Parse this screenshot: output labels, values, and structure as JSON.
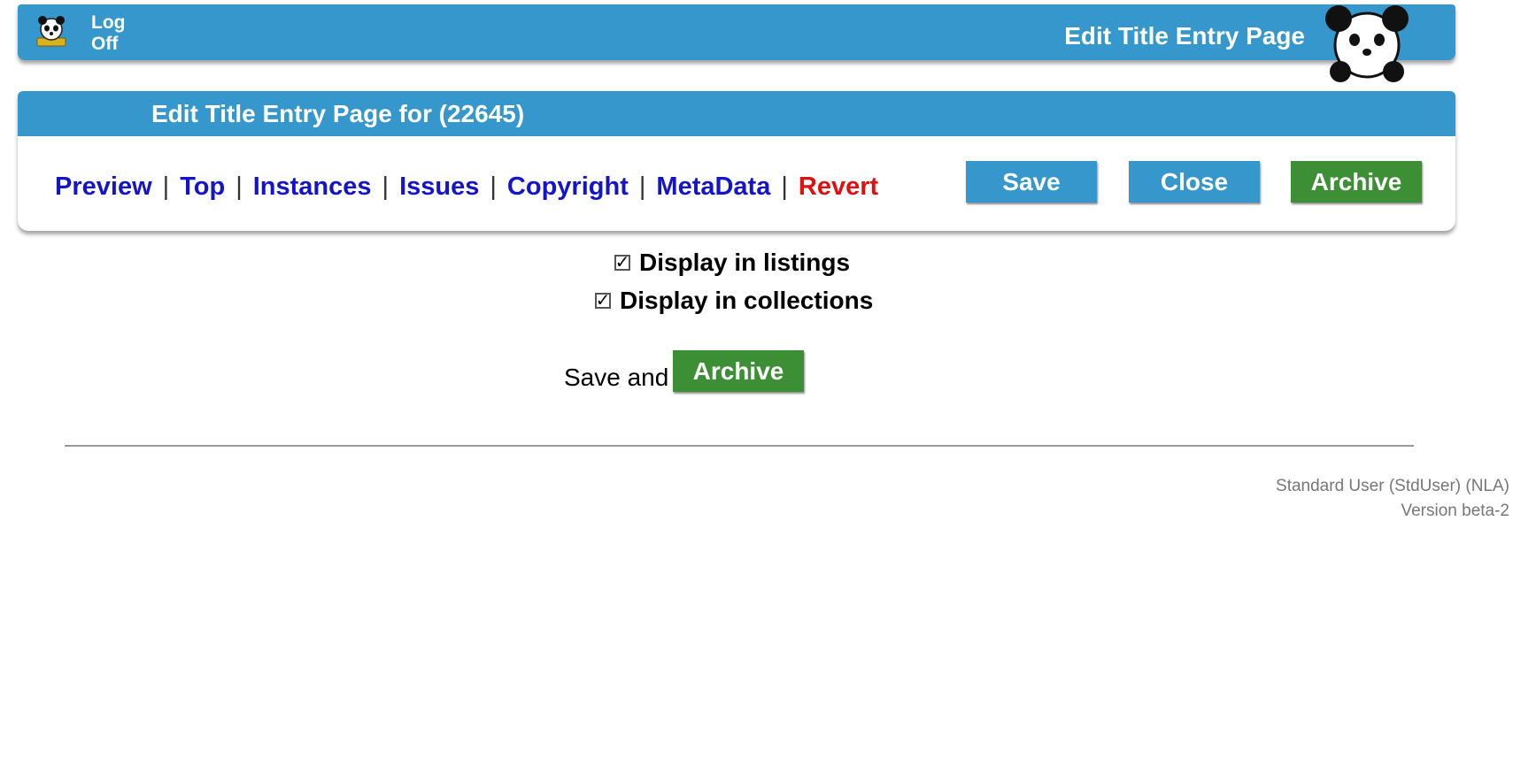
{
  "header": {
    "logoff_line1": "Log",
    "logoff_line2": "Off",
    "page_title": "Edit Title Entry Page"
  },
  "panel": {
    "title": "Edit Title Entry Page for (22645)",
    "nav": [
      "Preview",
      "Top",
      "Instances",
      "Issues",
      "Copyright",
      "MetaData",
      "Revert"
    ],
    "separator": "|",
    "buttons": {
      "save": "Save",
      "close": "Close",
      "archive": "Archive"
    }
  },
  "options": {
    "listings_label": "Display in listings",
    "listings_checked": true,
    "collections_label": "Display in collections",
    "collections_checked": true
  },
  "save_archive": {
    "prefix": "Save and",
    "button": "Archive"
  },
  "footer": {
    "user": "Standard User (StdUser) (NLA)",
    "version": "Version beta-2"
  },
  "colors": {
    "header_blue": "#3597cc",
    "archive_green": "#3d8f36",
    "link_blue": "#1414c8",
    "revert_red": "#e01010"
  }
}
